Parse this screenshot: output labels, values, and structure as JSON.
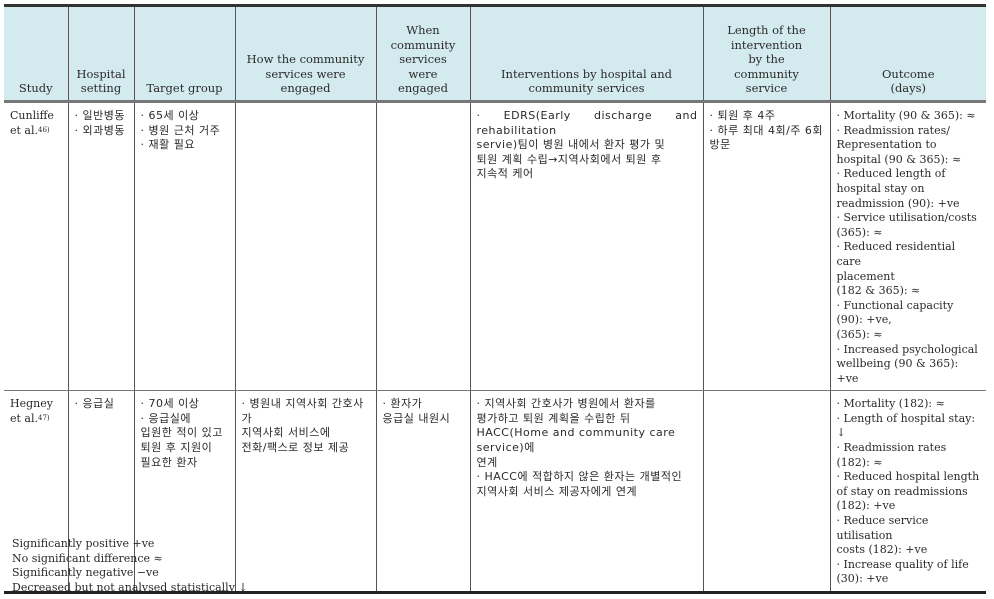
{
  "table": {
    "headers": [
      "Study",
      "Hospital setting",
      "Target group",
      "How the community services were engaged",
      "When community services were engaged",
      "Interventions by hospital and community services",
      "Length of the intervention by the community service",
      "Outcome (days)"
    ],
    "header_lines": [
      [
        "Study"
      ],
      [
        "Hospital",
        "setting"
      ],
      [
        "Target group"
      ],
      [
        "How the community",
        "services were",
        "engaged"
      ],
      [
        "When",
        "community",
        "services",
        "were",
        "engaged"
      ],
      [
        "Interventions by hospital and",
        "community services"
      ],
      [
        "Length of the",
        "intervention",
        "by the",
        "community",
        "service"
      ],
      [
        "Outcome",
        "(days)"
      ]
    ],
    "rows": [
      {
        "study": "Cunliffe et al.",
        "study_lines": [
          "Cunliffe",
          "et al."
        ],
        "ref": "46)",
        "hospital_setting": [
          "· 일반병동",
          "· 외과병동"
        ],
        "target_group": [
          "· 65세 이상",
          "· 병원 근처 거주",
          "· 재활 필요"
        ],
        "how_engaged": [],
        "when_engaged": [],
        "interventions": [
          "· EDRS(Early discharge and rehabilitation",
          "servie)팀이 병원 내에서 환자 평가 및",
          "퇴원 계획 수립→지역사회에서 퇴원 후",
          "지속적 케어"
        ],
        "length": [
          "· 퇴원 후 4주",
          "· 하루 최대 4회/주 6회",
          "방문"
        ],
        "outcome": [
          "· Mortality (90 & 365): ≈",
          "· Readmission rates/",
          "Representation to",
          "hospital (90 & 365): ≈",
          "· Reduced length of",
          "hospital stay on",
          "readmission (90): +ve",
          "· Service utilisation/costs",
          "(365): ≈",
          "· Reduced residential care",
          "placement",
          "(182 & 365): ≈",
          "· Functional capacity",
          "(90): +ve,",
          "(365): ≈",
          "· Increased psychological",
          "wellbeing (90 & 365): +ve"
        ]
      },
      {
        "study": "Hegney et al.",
        "study_lines": [
          "Hegney",
          "et al."
        ],
        "ref": "47)",
        "hospital_setting": [
          "· 응급실"
        ],
        "target_group": [
          "· 70세 이상",
          "· 응급실에",
          "입원한 적이 있고",
          "퇴원 후 지원이",
          "필요한 환자"
        ],
        "how_engaged": [
          "· 병원내 지역사회 간호사가",
          "지역사회 서비스에",
          "전화/팩스로 정보 제공"
        ],
        "when_engaged": [
          "· 환자가",
          "응급실 내원시"
        ],
        "interventions": [
          "· 지역사회 간호사가 병원에서 환자를",
          "평가하고 퇴원 계획을 수립한 뒤",
          "HACC(Home and community care service)에",
          "연계",
          "· HACC에 적합하지 않은 환자는 개별적인",
          "지역사회 서비스 제공자에게 연계"
        ],
        "length": [],
        "outcome": [
          "· Mortality (182): ≈",
          "· Length of hospital stay: ↓",
          "· Readmission rates (182): ≈",
          "· Reduced hospital length",
          "of stay on readmissions",
          "(182): +ve",
          "· Reduce service utilisation",
          "costs (182): +ve",
          "· Increase quality of life",
          "(30): +ve"
        ]
      }
    ]
  },
  "legend": [
    "Significantly positive +ve",
    "No significant difference ≈",
    "Significantly negative −ve",
    "Decreased but not analysed statistically ↓"
  ],
  "colors": {
    "header_bg": "#d3eaee",
    "text": "#2a2a2a",
    "rule": "#333333"
  }
}
